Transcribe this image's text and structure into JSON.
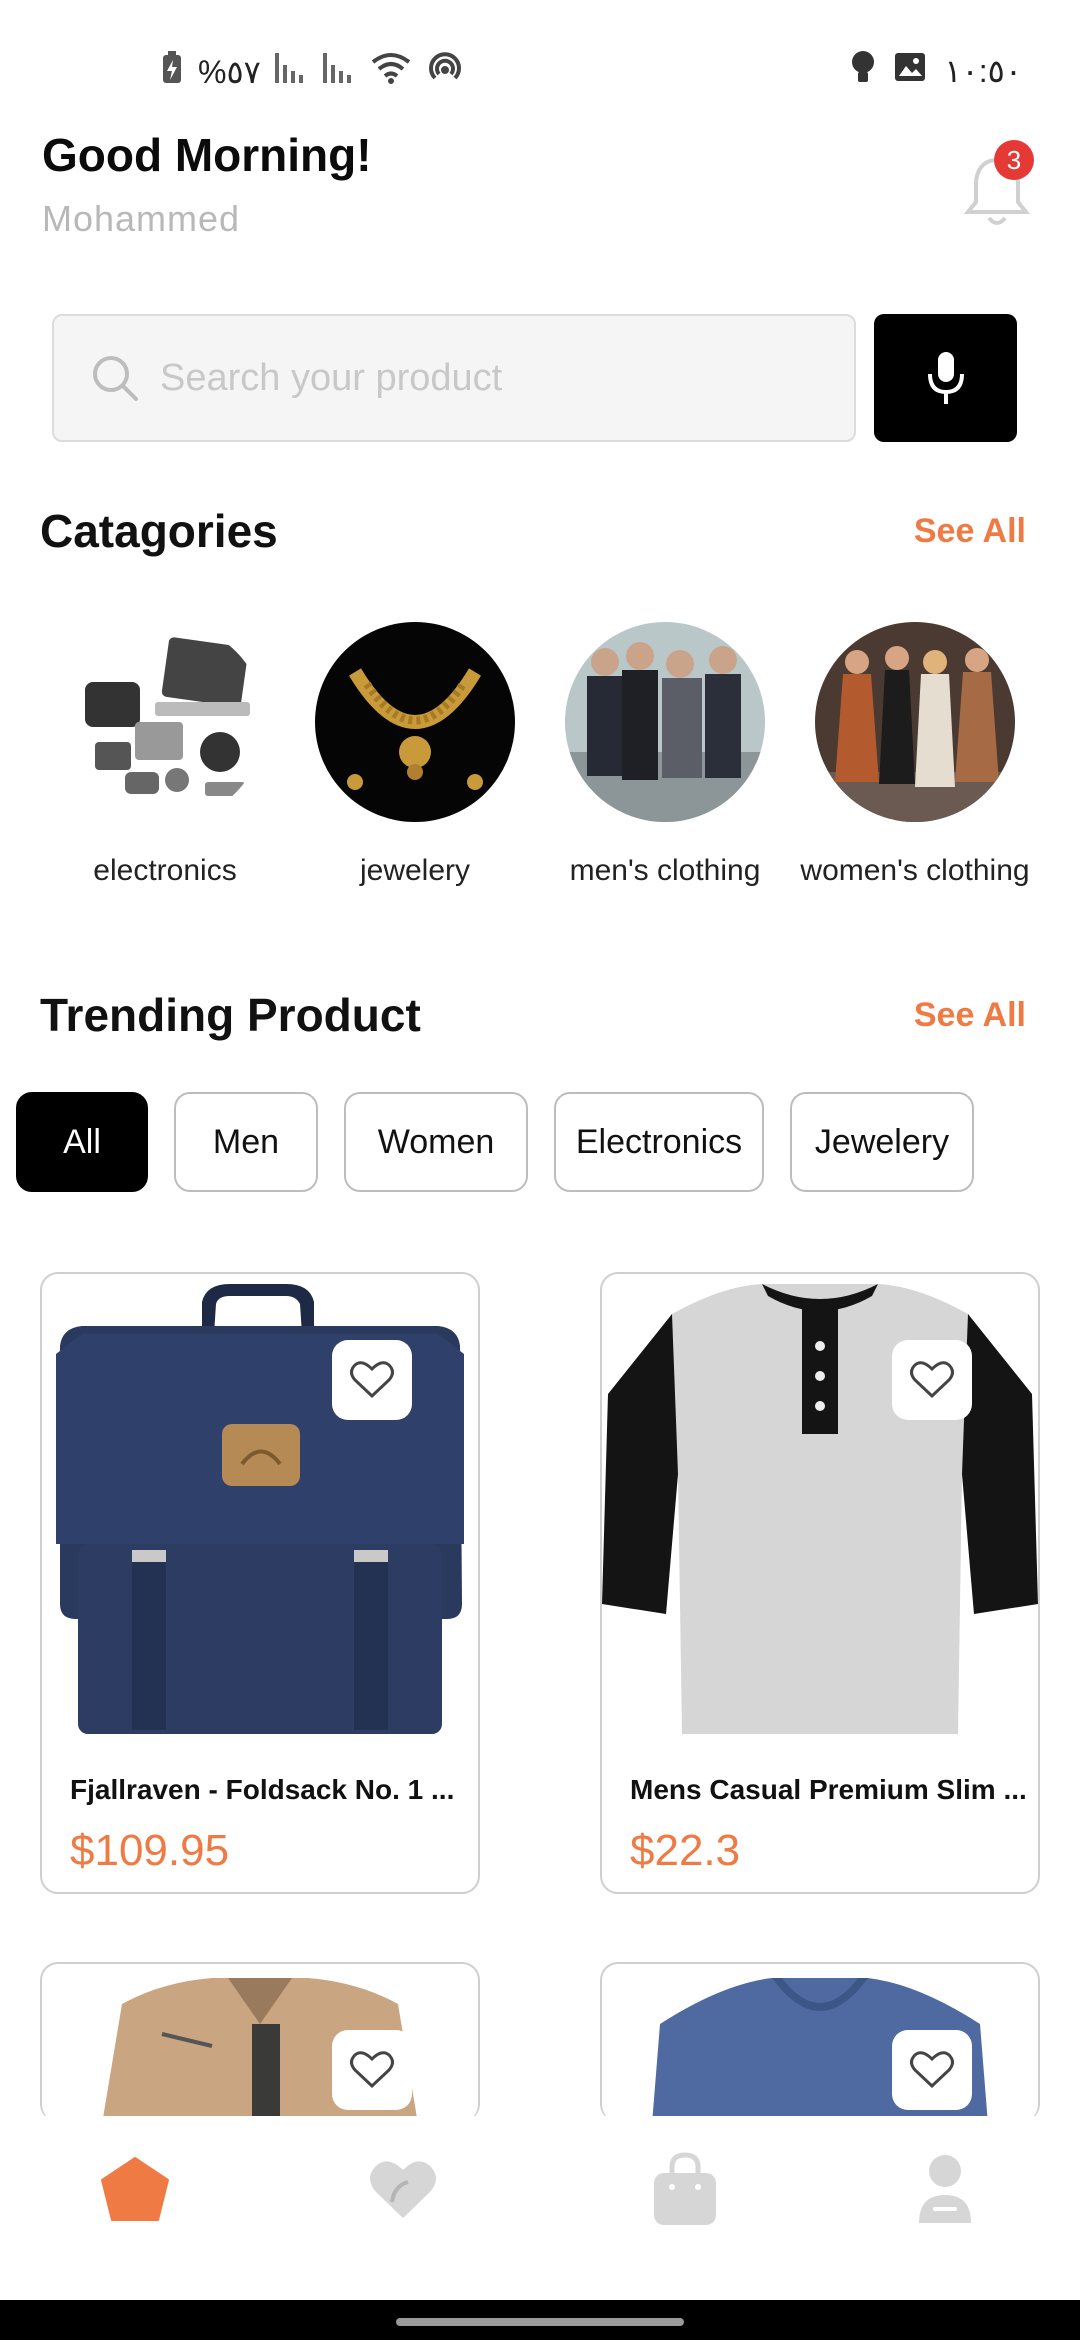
{
  "status_bar": {
    "battery": "%٥٧",
    "time": "١٠:٥٠"
  },
  "header": {
    "greeting": "Good Morning!",
    "username": "Mohammed",
    "notification_count": "3"
  },
  "search": {
    "placeholder": "Search your product"
  },
  "categories": {
    "title": "Catagories",
    "see_all": "See All",
    "items": [
      {
        "label": "electronics"
      },
      {
        "label": "jewelery"
      },
      {
        "label": "men's clothing"
      },
      {
        "label": "women's clothing"
      }
    ]
  },
  "trending": {
    "title": "Trending Product",
    "see_all": "See All",
    "filters": [
      "All",
      "Men",
      "Women",
      "Electronics",
      "Jewelery"
    ],
    "active_filter": "All",
    "products": [
      {
        "title": "Fjallraven - Foldsack No. 1 ...",
        "price": "$109.95"
      },
      {
        "title": "Mens Casual Premium Slim ...",
        "price": "$22.3"
      }
    ]
  },
  "bottom_nav": {
    "items": [
      "home-icon",
      "heart-icon",
      "bag-icon",
      "profile-icon"
    ],
    "active": "home-icon"
  },
  "colors": {
    "accent": "#f07a43",
    "badge": "#e53935"
  }
}
